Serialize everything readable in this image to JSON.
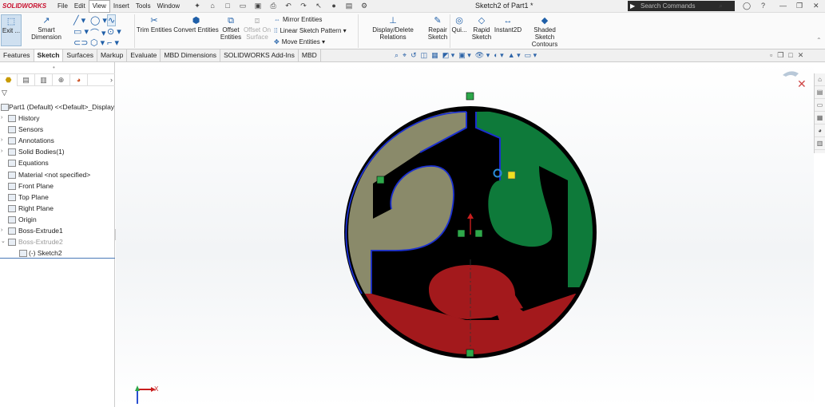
{
  "app": {
    "logo_text": "SOLIDWORKS",
    "document_title": "Sketch2 of Part1 *",
    "search_placeholder": "Search Commands"
  },
  "menu": [
    "File",
    "Edit",
    "View",
    "Insert",
    "Tools",
    "Window"
  ],
  "menu_active": "View",
  "ribbon": {
    "exit_sketch": "Exit ...",
    "smart_dimension": "Smart Dimension",
    "trim_entities": "Trim Entities",
    "convert_entities": "Convert Entities",
    "offset_entities_1": "Offset",
    "offset_entities_2": "Entities",
    "offset_on_surface_1": "Offset On",
    "offset_on_surface_2": "Surface",
    "mirror_entities": "Mirror Entities",
    "linear_sketch_pattern": "Linear Sketch Pattern",
    "move_entities": "Move Entities",
    "display_delete_relations": "Display/Delete Relations",
    "repair_sketch_1": "Repair",
    "repair_sketch_2": "Sketch",
    "quick_snaps": "Qui...",
    "rapid_sketch_1": "Rapid",
    "rapid_sketch_2": "Sketch",
    "instant2d": "Instant2D",
    "shaded_contours_1": "Shaded Sketch",
    "shaded_contours_2": "Contours"
  },
  "tabs": [
    "Features",
    "Sketch",
    "Surfaces",
    "Markup",
    "Evaluate",
    "MBD Dimensions",
    "SOLIDWORKS Add-Ins",
    "MBD"
  ],
  "tab_active": "Sketch",
  "tree": [
    {
      "label": "Part1 (Default) <<Default>_Display",
      "level": 0,
      "arrow": ""
    },
    {
      "label": "History",
      "level": 1,
      "arrow": "›"
    },
    {
      "label": "Sensors",
      "level": 1,
      "arrow": ""
    },
    {
      "label": "Annotations",
      "level": 1,
      "arrow": "›"
    },
    {
      "label": "Solid Bodies(1)",
      "level": 1,
      "arrow": "›"
    },
    {
      "label": "Equations",
      "level": 1,
      "arrow": ""
    },
    {
      "label": "Material <not specified>",
      "level": 1,
      "arrow": ""
    },
    {
      "label": "Front Plane",
      "level": 1,
      "arrow": ""
    },
    {
      "label": "Top Plane",
      "level": 1,
      "arrow": ""
    },
    {
      "label": "Right Plane",
      "level": 1,
      "arrow": ""
    },
    {
      "label": "Origin",
      "level": 1,
      "arrow": ""
    },
    {
      "label": "Boss-Extrude1",
      "level": 1,
      "arrow": "›"
    },
    {
      "label": "Boss-Extrude2",
      "level": 1,
      "arrow": "⌄",
      "dim": true
    },
    {
      "label": "(-) Sketch2",
      "level": 2,
      "arrow": ""
    }
  ],
  "triad": {
    "x_label": "X"
  },
  "colors": {
    "region_tan": "#8a8a6a",
    "region_green": "#0e7a3a",
    "region_red": "#a3191c",
    "sketch_blue": "#1a2fd0",
    "outline": "#000000"
  }
}
